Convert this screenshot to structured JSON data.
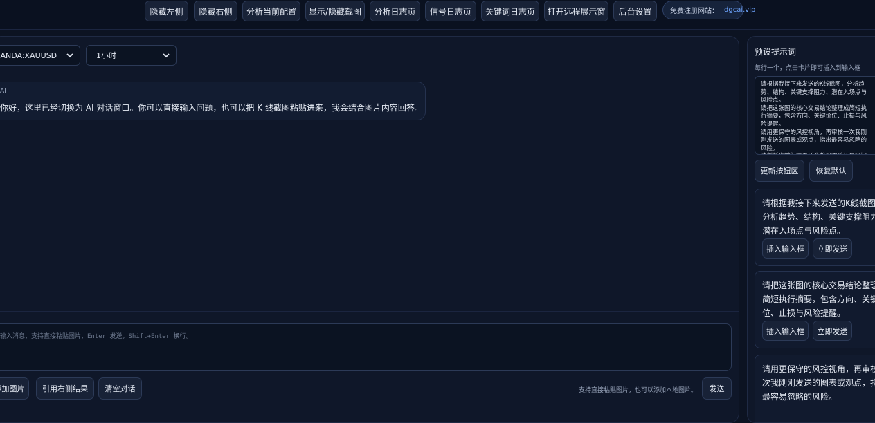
{
  "toolbar": {
    "buttons": [
      "隐藏左侧",
      "隐藏右侧",
      "分析当前配置",
      "显示/隐藏截图",
      "分析日志页",
      "信号日志页",
      "关键词日志页",
      "打开远程展示窗",
      "后台设置"
    ],
    "site_label": "免费注册网站：",
    "site_link": "dgcai.vip"
  },
  "chat": {
    "symbol_select": "OANDA:XAUUSD",
    "interval_select": "1小时",
    "messages": [
      {
        "role": "AI",
        "text": "你好，这里已经切换为 AI 对话窗口。你可以直接输入问题，也可以把 K 线截图粘贴进来，我会结合图片内容回答。"
      }
    ],
    "composer_placeholder": "输入消息，支持直接粘贴图片，Enter 发送，Shift+Enter 换行。",
    "add_image": "添加图片",
    "quote_right": "引用右侧结果",
    "clear": "清空对话",
    "hint": "支持直接粘贴图片，也可以添加本地图片。",
    "send": "发送"
  },
  "presets": {
    "title": "预设提示词",
    "subtitle": "每行一个，点击卡片即可插入到输入框",
    "textarea": "请根据我接下来发送的K线截图，分析趋\n势、结构、关键支撑阻力、潜在入场点与\n风险点。\n请把这张图的核心交易结论整理成简短执\n行摘要，包含方向、关键价位、止损与风\n险提醒。\n请用更保守的风控视角，再审核一次我刚\n刚发送的图表或观点，指出最容易忽略的\n风险。\n请判断当前行情更适合趋势跟随还是区间",
    "update": "更新按钮区",
    "restore": "恢复默认",
    "insert": "插入输入框",
    "send_now": "立即发送",
    "cards": [
      {
        "lines": [
          "请根据我接下来发送的K线截图，",
          "分析趋势、结构、关键支撑阻力、",
          "潜在入场点与风险点。"
        ]
      },
      {
        "lines": [
          "请把这张图的核心交易结论整理成",
          "简短执行摘要，包含方向、关键价",
          "位、止损与风险提醒。"
        ]
      },
      {
        "lines": [
          "请用更保守的风控视角，再审核一",
          "次我刚刚发送的图表或观点，指出",
          "最容易忽略的风险。"
        ]
      }
    ]
  }
}
